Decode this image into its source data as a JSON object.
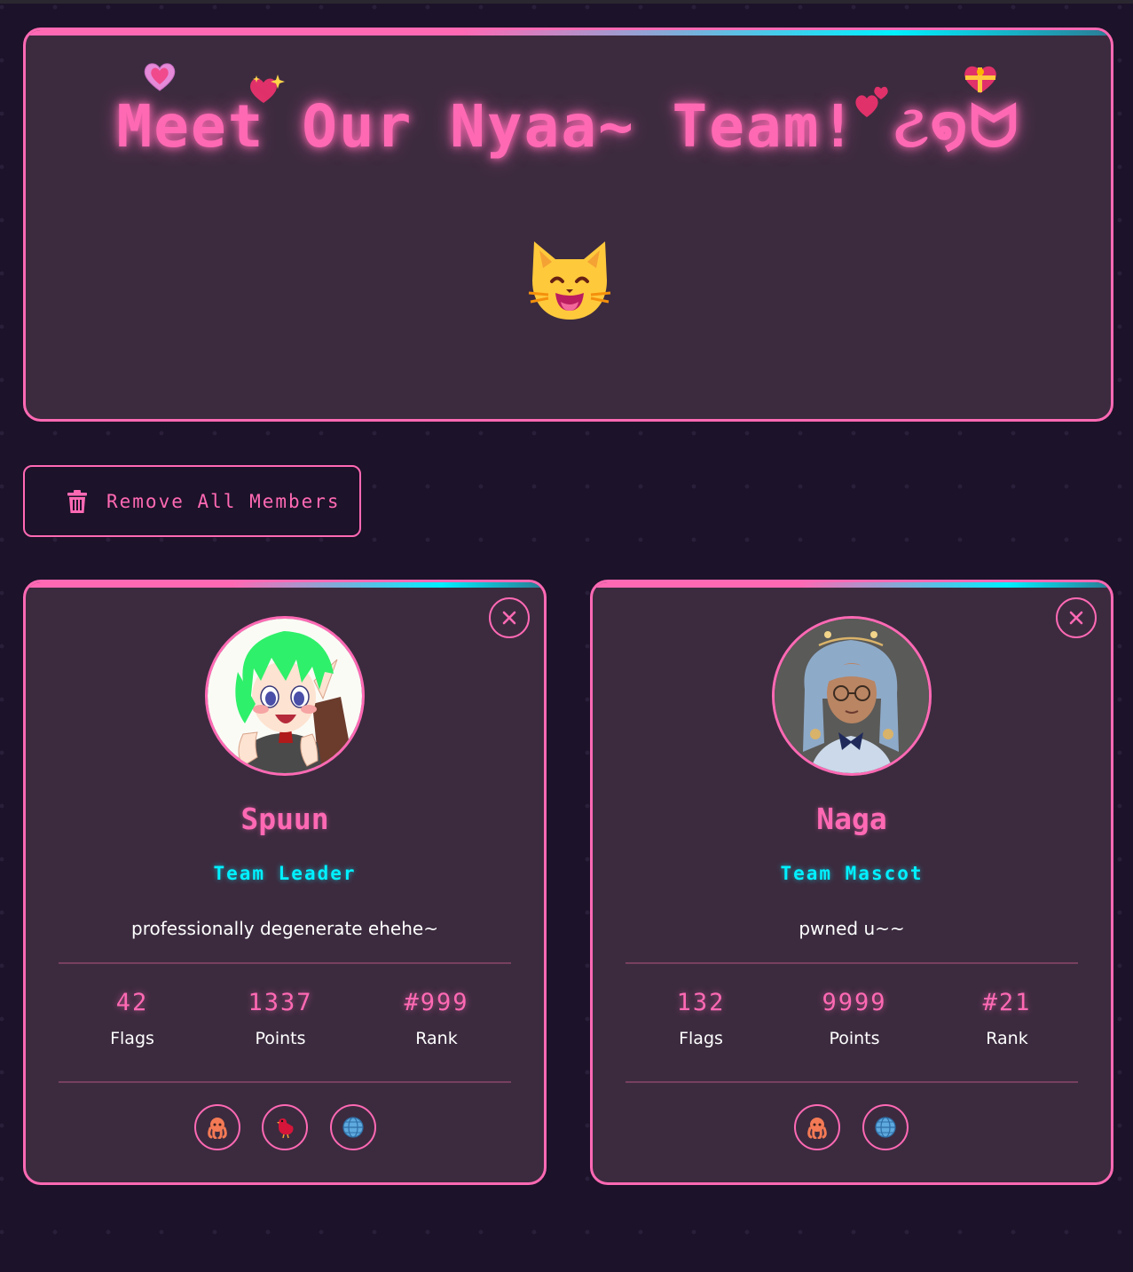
{
  "hero": {
    "title": "Meet Our Nyaa~ Team! ટ໑ᗢ",
    "hearts": [
      "heart-icon",
      "sparkling-heart-icon",
      "two-hearts-icon",
      "heart-with-ribbon-icon"
    ],
    "emoji": "smiling-cat-icon"
  },
  "actions": {
    "remove_all_label": "Remove All Members",
    "remove_all_icon": "trash-icon"
  },
  "members": [
    {
      "name": "Spuun",
      "role": "Team Leader",
      "bio": "professionally degenerate ehehe~",
      "avatar": "anime-girl-green-hair",
      "stats": [
        {
          "value": "42",
          "label": "Flags"
        },
        {
          "value": "1337",
          "label": "Points"
        },
        {
          "value": "#999",
          "label": "Rank"
        }
      ],
      "socials": [
        "github-octopus-icon",
        "twitter-bird-icon",
        "website-globe-icon"
      ]
    },
    {
      "name": "Naga",
      "role": "Team Mascot",
      "bio": "pwned u~~",
      "avatar": "cosplay-girl-blue-hair",
      "stats": [
        {
          "value": "132",
          "label": "Flags"
        },
        {
          "value": "9999",
          "label": "Points"
        },
        {
          "value": "#21",
          "label": "Rank"
        }
      ],
      "socials": [
        "github-octopus-icon",
        "website-globe-icon"
      ]
    }
  ],
  "colors": {
    "background": "#1c1229",
    "panel": "#3c2b3f",
    "accent_pink": "#ff69b4",
    "accent_cyan": "#00f0ff"
  }
}
